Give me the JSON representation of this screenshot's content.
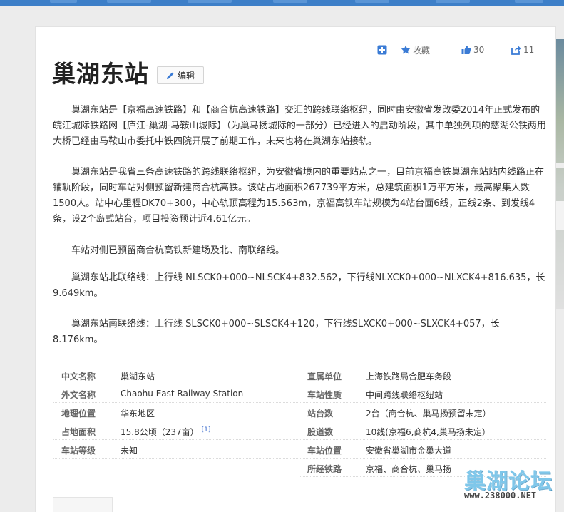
{
  "page": {
    "title": "巢湖东站",
    "edit_label": "编辑"
  },
  "actions": {
    "favorite_label": "收藏",
    "like_count": "30",
    "share_count": "11"
  },
  "paragraphs": [
    "巢湖东站是【京福高速铁路】和【商合杭高速铁路】交汇的跨线联络枢纽，同时由安徽省发改委2014年正式发布的皖江城际铁路网【庐江-巢湖-马鞍山城际】（为巢马扬城际的一部分）已经进入的启动阶段，其中单独列项的慈湖公铁两用大桥已经由马鞍山市委托中铁四院开展了前期工作，未来也将在巢湖东站接轨。",
    "巢湖东站是我省三条高速铁路的跨线联络枢纽，为安徽省境内的重要站点之一，目前京福高铁巢湖东站站内线路正在铺轨阶段，同时车站对侧预留新建商合杭高铁。该站占地面积267739平方米，总建筑面积1万平方米，最高聚集人数1500人。站中心里程DK70+300，中心轨顶高程为15.563m，京福高铁车站规模为4站台面6线，正线2条、到发线4条，设2个岛式站台，项目投资预计近4.61亿元。",
    "车站对侧已预留商合杭高铁新建场及北、南联络线。",
    "巢湖东站北联络线：上行线 NLSCK0+000~NLSCK4+832.562，下行线NLXCK0+000~NLXCK4+816.635，长 9.649km。",
    "巢湖东站南联络线：上行线 SLSCK0+000~SLSCK4+120，下行线SLXCK0+000~SLXCK4+057，长 8.176km。"
  ],
  "infobox": {
    "rows": [
      {
        "lk": "中文名称",
        "lv": "巢湖东站",
        "rk": "直属单位",
        "rv": "上海铁路局合肥车务段"
      },
      {
        "lk": "外文名称",
        "lv": "Chaohu East Railway Station",
        "rk": "车站性质",
        "rv": "中间跨线联络枢纽站"
      },
      {
        "lk": "地理位置",
        "lv": "华东地区",
        "rk": "站台数",
        "rv": "2台（商合杭、巢马扬预留未定）"
      },
      {
        "lk": "占地面积",
        "lv": "15.8公顷（237亩）",
        "rk": "股道数",
        "rv": "10线(京福6,商杭4,巢马扬未定）"
      },
      {
        "lk": "车站等级",
        "lv": "未知",
        "rk": "车站位置",
        "rv": "安徽省巢湖市金巢大道"
      },
      {
        "lk": "",
        "lv": "",
        "rk": "所经铁路",
        "rv": "京福、商合杭、巢马扬"
      }
    ],
    "area_ref": "[1]"
  },
  "watermark": {
    "title": "巢湖论坛",
    "url": "www.238000.NET"
  },
  "colors": {
    "nav_blue": "#3d7fc8",
    "icon_blue": "#3a7bd5",
    "watermark": "#7fc7ea"
  }
}
